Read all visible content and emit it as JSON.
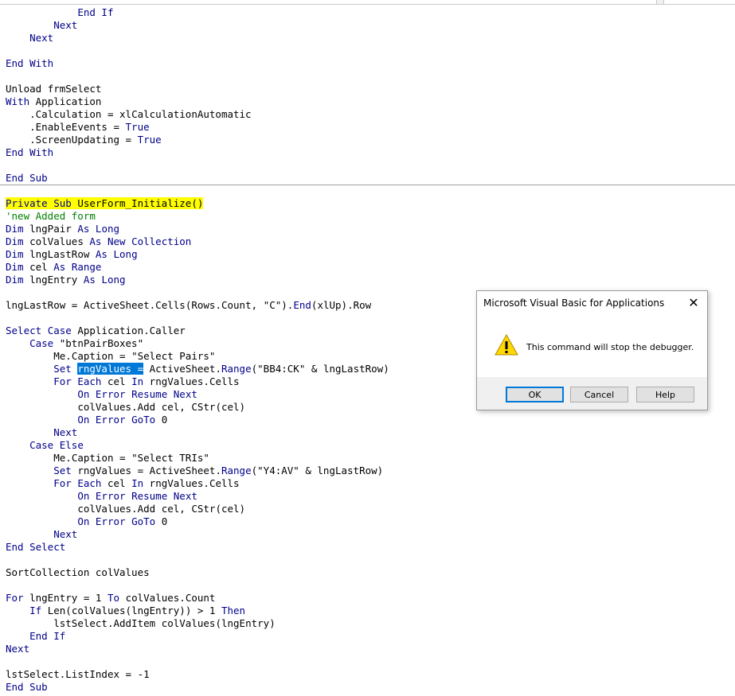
{
  "editor": {
    "lines": [
      "            End If",
      "        Next",
      "    Next",
      "",
      "End With",
      "",
      "Unload frmSelect",
      "With Application",
      "    .Calculation = xlCalculationAutomatic",
      "    .EnableEvents = True",
      "    .ScreenUpdating = True",
      "End With",
      "",
      "End Sub",
      "",
      "Private Sub UserForm_Initialize()",
      "'new Added form",
      "Dim lngPair As Long",
      "Dim colValues As New Collection",
      "Dim lngLastRow As Long",
      "Dim cel As Range",
      "Dim lngEntry As Long",
      "",
      "lngLastRow = ActiveSheet.Cells(Rows.Count, \"C\").End(xlUp).Row",
      "",
      "Select Case Application.Caller",
      "    Case \"btnPairBoxes\"",
      "        Me.Caption = \"Select Pairs\"",
      "        Set rngValues = ActiveSheet.Range(\"BB4:CK\" & lngLastRow)",
      "        For Each cel In rngValues.Cells",
      "            On Error Resume Next",
      "            colValues.Add cel, CStr(cel)",
      "            On Error GoTo 0",
      "        Next",
      "    Case Else",
      "        Me.Caption = \"Select TRIs\"",
      "        Set rngValues = ActiveSheet.Range(\"Y4:AV\" & lngLastRow)",
      "        For Each cel In rngValues.Cells",
      "            On Error Resume Next",
      "            colValues.Add cel, CStr(cel)",
      "            On Error GoTo 0",
      "        Next",
      "End Select",
      "",
      "SortCollection colValues",
      "",
      "For lngEntry = 1 To colValues.Count",
      "    If Len(colValues(lngEntry)) > 1 Then",
      "        lstSelect.AddItem colValues(lngEntry)",
      "    End If",
      "Next",
      "",
      "lstSelect.ListIndex = -1",
      "End Sub"
    ],
    "current_statement_line": 15,
    "selection": {
      "line": 28,
      "text": "rngValues ="
    }
  },
  "dialog": {
    "title": "Microsoft Visual Basic for Applications",
    "message": "This command will stop the debugger.",
    "ok_label": "OK",
    "cancel_label": "Cancel",
    "help_label": "Help",
    "icon": "warning-icon",
    "close_glyph": "✕"
  },
  "colors": {
    "keyword": "#00008b",
    "comment": "#008000",
    "current_statement_bg": "#ffff00",
    "selection_bg": "#0078d7"
  }
}
